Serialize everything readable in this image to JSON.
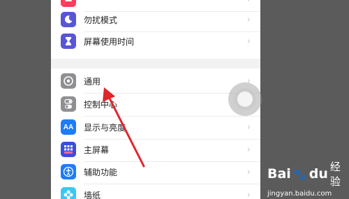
{
  "settings": {
    "items": [
      {
        "label": "",
        "icon": "bell-icon",
        "color": "#ff3b5c"
      },
      {
        "label": "勿扰模式",
        "icon": "moon-icon",
        "color": "#5856d6"
      },
      {
        "label": "屏幕使用时间",
        "icon": "hourglass-icon",
        "color": "#5856d6"
      },
      {
        "label": "通用",
        "icon": "gear-icon",
        "color": "#8e8e93"
      },
      {
        "label": "控制中心",
        "icon": "toggles-icon",
        "color": "#8e8e93"
      },
      {
        "label": "显示与亮度",
        "icon": "aa-icon",
        "color": "#1e7cf6"
      },
      {
        "label": "主屏幕",
        "icon": "grid-icon",
        "color": "#3b4fd8"
      },
      {
        "label": "辅助功能",
        "icon": "accessibility-icon",
        "color": "#1e7cf6"
      },
      {
        "label": "墙纸",
        "icon": "flower-icon",
        "color": "#3ac8f5"
      }
    ],
    "aa_glyph": "AA",
    "chevron": "›"
  },
  "watermark": {
    "brand": "Bai",
    "brand_suffix": "du",
    "product": "经验",
    "url": "jingyan.baidu.com"
  }
}
